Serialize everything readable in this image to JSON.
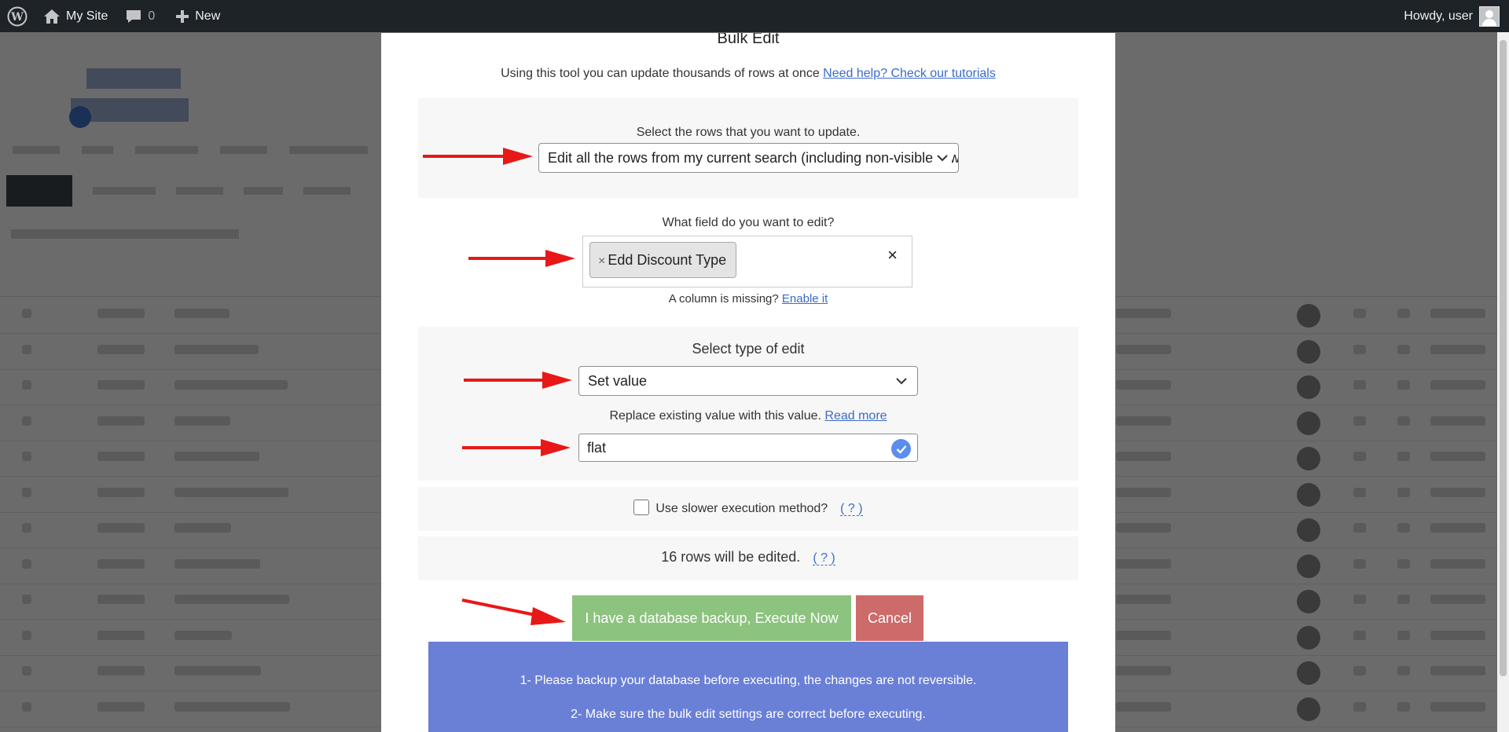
{
  "adminbar": {
    "site_name": "My Site",
    "comments_count": "0",
    "new_label": "New",
    "howdy": "Howdy, user"
  },
  "modal": {
    "title": "Bulk Edit",
    "intro": "Using this tool you can update thousands of rows at once",
    "help_link": "Need help? Check our tutorials",
    "rows_label": "Select the rows that you want to update.",
    "rows_select_value": "Edit all the rows from my current search (including non-visible rows).",
    "field_label": "What field do you want to edit?",
    "field_tag": "Edd Discount Type",
    "tag_remove": "×",
    "clear": "×",
    "missing_text": "A column is missing?",
    "missing_link": "Enable it",
    "edit_type_label": "Select type of edit",
    "edit_type_value": "Set value",
    "replace_text": "Replace existing value with this value.",
    "read_more": "Read more",
    "value_input": "flat",
    "slower_label": "Use slower execution method?",
    "help_q": "( ? )",
    "rows_count_text": "16 rows will be edited.",
    "execute_button": "I have a database backup, Execute Now",
    "cancel_button": "Cancel",
    "notes": [
      "1- Please backup your database before executing, the changes are not reversible.",
      "2- Make sure the bulk edit settings are correct before executing."
    ]
  },
  "colors": {
    "execute": "#8cc37e",
    "cancel": "#cd6a6a",
    "info": "#6a7fd6",
    "link": "#3a6bc8",
    "arrow": "#e81818"
  }
}
